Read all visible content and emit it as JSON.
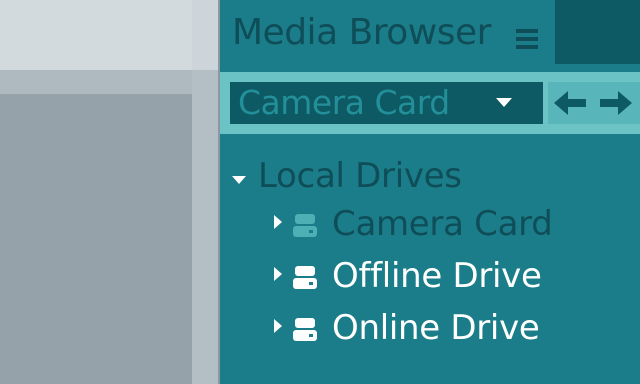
{
  "panel": {
    "title": "Media Browser",
    "menu_icon": "hamburger-menu-icon",
    "source_selector": {
      "selected": "Camera Card",
      "icon": "chevron-down-icon"
    },
    "nav": {
      "back_icon": "arrow-left-icon",
      "forward_icon": "arrow-right-icon"
    }
  },
  "tree": {
    "group": {
      "label": "Local Drives",
      "expanded": true
    },
    "items": [
      {
        "label": "Camera Card",
        "icon": "drive-icon",
        "state": "dimmed"
      },
      {
        "label": "Offline Drive",
        "icon": "drive-icon",
        "state": "normal"
      },
      {
        "label": "Online Drive",
        "icon": "drive-icon",
        "state": "normal"
      }
    ]
  },
  "colors": {
    "panel_bg": "#1a7d89",
    "header_text": "#0f4e58",
    "toolbar_bg": "#6bc3c6",
    "selector_bg": "#0d5a64",
    "dim_text": "#0f4e58",
    "bright_text": "#ffffff"
  }
}
